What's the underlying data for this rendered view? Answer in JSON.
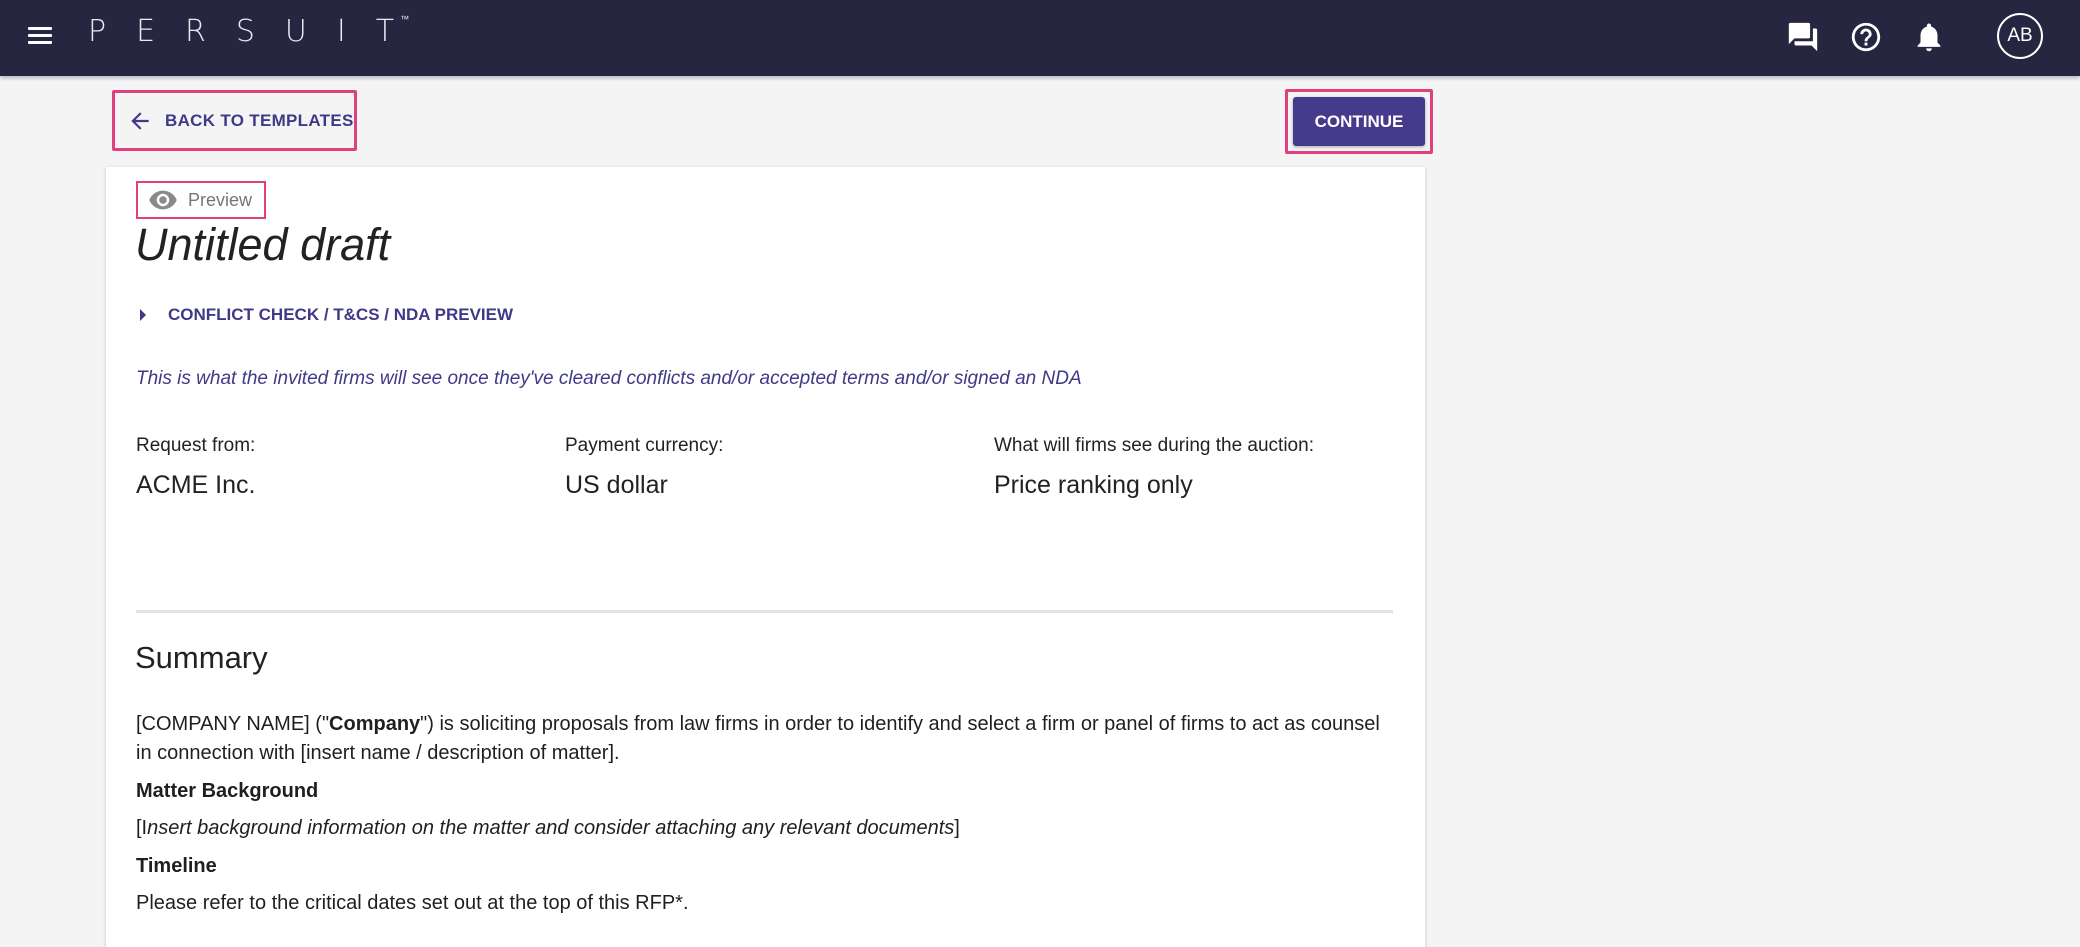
{
  "header": {
    "logo_text": "PERSUIT",
    "logo_tm": "™",
    "avatar_initials": "AB",
    "icons": [
      "menu-icon",
      "chat-icon",
      "help-icon",
      "notification-bell-icon"
    ],
    "background_color": "#272640"
  },
  "actions": {
    "back_label": "BACK TO TEMPLATES",
    "continue_label": "CONTINUE"
  },
  "card": {
    "preview_label": "Preview",
    "title": "Untitled draft",
    "conflict_label": "CONFLICT CHECK / T&CS / NDA PREVIEW",
    "note": "This is what the invited firms will see once they've cleared conflicts and/or accepted terms and/or signed an NDA",
    "info": {
      "request_from_label": "Request from:",
      "request_from_value": "ACME Inc.",
      "currency_label": "Payment currency:",
      "currency_value": "US dollar",
      "auction_label": "What will firms see during the auction:",
      "auction_value": "Price ranking only"
    },
    "summary": {
      "heading": "Summary",
      "intro_prefix": "[COMPANY NAME] (\"",
      "intro_bold": "Company",
      "intro_suffix": "\") is soliciting proposals from law firms in order to identify and select a firm or panel of firms to act as counsel in connection with [insert name / description of matter].",
      "matter_heading": "Matter Background",
      "matter_open": "[I",
      "matter_italic": "nsert background information on the matter and consider attaching any relevant documents",
      "matter_close": "]",
      "timeline_heading": "Timeline",
      "timeline_text": "Please refer to the critical dates set out at the top of this RFP*."
    }
  },
  "colors": {
    "accent": "#3f3987",
    "button": "#463a8c",
    "highlight": "#e0407e"
  }
}
